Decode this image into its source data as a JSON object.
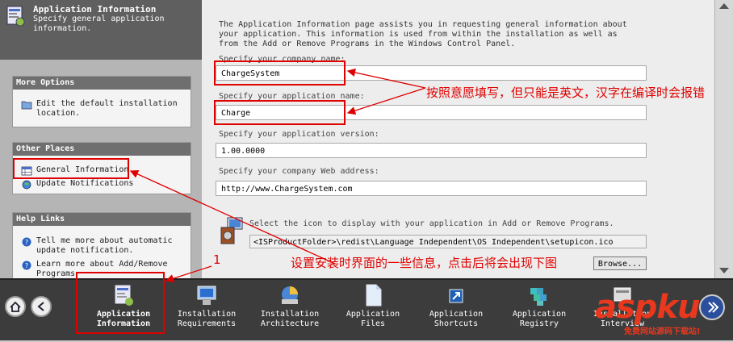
{
  "banner": {
    "title": "Application Information",
    "subtitle": "Specify general application information."
  },
  "more_options": {
    "header": "More Options",
    "items": [
      {
        "label": "Edit the default installation location.",
        "icon": "folder-icon"
      }
    ]
  },
  "other_places": {
    "header": "Other Places",
    "items": [
      {
        "label": "General Information",
        "icon": "table-icon"
      },
      {
        "label": "Update Notifications",
        "icon": "globe-icon"
      }
    ]
  },
  "help_links": {
    "header": "Help Links",
    "items": [
      {
        "label": "Tell me more about automatic update notification.",
        "icon": "help-icon"
      },
      {
        "label": "Learn more about Add/Remove Programs",
        "icon": "help-icon"
      }
    ]
  },
  "main": {
    "description": "The Application Information page assists you in requesting general information about your application. This information is used from within the installation as well as from the Add or Remove Programs in the Windows Control Panel.",
    "company_name_label": "Specify your company name:",
    "company_name_value": "ChargeSystem",
    "app_name_label": "Specify your application name:",
    "app_name_value": "Charge",
    "app_version_label": "Specify your application version:",
    "app_version_value": "1.00.0000",
    "web_address_label": "Specify your company Web address:",
    "web_address_value": "http://www.ChargeSystem.com",
    "icon_label": "Select the icon to display with your application in Add or Remove Programs.",
    "icon_path_value": "<ISProductFolder>\\redist\\Language Independent\\OS Independent\\setupicon.ico",
    "browse_label": "Browse..."
  },
  "steps": [
    {
      "line1": "Application",
      "line2": "Information",
      "icon": "app-info-icon",
      "active": true
    },
    {
      "line1": "Installation",
      "line2": "Requirements",
      "icon": "requirements-icon"
    },
    {
      "line1": "Installation",
      "line2": "Architecture",
      "icon": "architecture-icon"
    },
    {
      "line1": "Application",
      "line2": "Files",
      "icon": "files-icon"
    },
    {
      "line1": "Application",
      "line2": "Shortcuts",
      "icon": "shortcut-icon"
    },
    {
      "line1": "Application",
      "line2": "Registry",
      "icon": "registry-icon"
    },
    {
      "line1": "Installation",
      "line2": "Interview",
      "icon": "interview-icon"
    }
  ],
  "annotations": {
    "note1": "按照意愿填写，但只能是英文，汉字在编译时会报错",
    "note2": "设置安装时界面的一些信息，点击后将会出现下图",
    "marker": "1"
  },
  "watermark": {
    "main": "aspku",
    "sub": "免费网站源码下载站!"
  },
  "colors": {
    "annotation": "#e00000",
    "banner": "#5f5f5f",
    "bottom_bar": "#3c3c3c"
  }
}
